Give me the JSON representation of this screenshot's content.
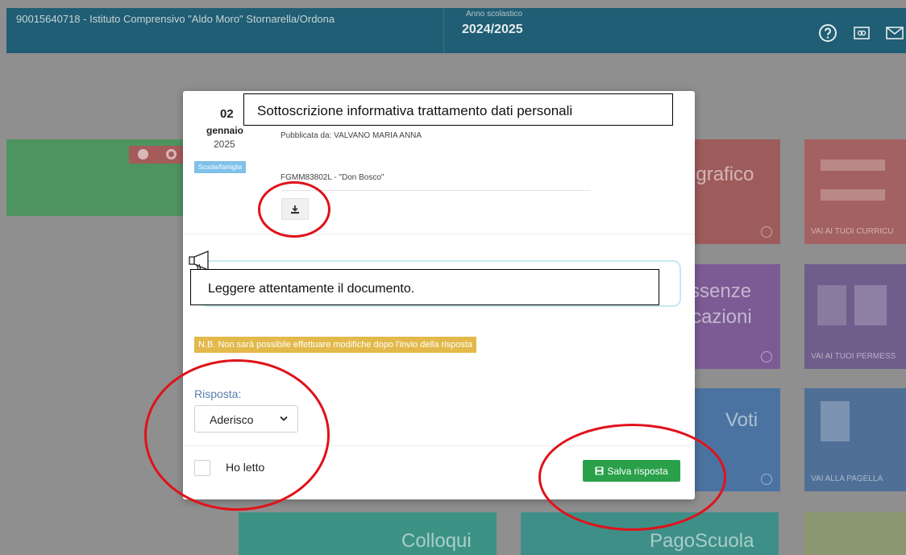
{
  "header": {
    "school_name": "90015640718 - Istituto Comprensivo \"Aldo Moro\" Stornarella/Ordona",
    "year_label": "Anno scolastico",
    "year_value": "2024/2025",
    "icons": [
      "help-icon",
      "card-icon",
      "mail-icon"
    ]
  },
  "tiles": {
    "anagrafico": "ngrafico",
    "curriculum_link": "VAI AI TUOI CURRICU",
    "assenze_line1": "ssenze",
    "assenze_line2": "cazioni",
    "permessi_link": "VAI AI TUOI PERMESS",
    "voti": "Voti",
    "pagella_link": "VAI ALLA PAGELLA",
    "colloqui": "Colloqui",
    "pagoscuola": "PagoScuola"
  },
  "modal": {
    "date_day": "02",
    "date_month": "gennaio",
    "date_year": "2025",
    "category": "Scuola/famiglia",
    "title": "Sottoscrizione informativa trattamento dati personali",
    "published_by": "Pubblicata da: VALVANO MARIA ANNA",
    "school_code": "FGMM83802L - \"Don Bosco\"",
    "note": "Leggere attentamente il documento.",
    "warning": "N.B. Non sarà possibile effettuare modifiche dopo l'invio della risposta",
    "answer_label": "Risposta:",
    "answer_value": "Aderisco",
    "read_label": "Ho letto",
    "save_label": "Salva risposta"
  },
  "colors": {
    "header_bg": "#1f5e74",
    "save_button": "#2aa04a",
    "warning_badge": "#e2b94a",
    "category_badge": "#7fc1ea",
    "annotation": "#e0121a"
  }
}
